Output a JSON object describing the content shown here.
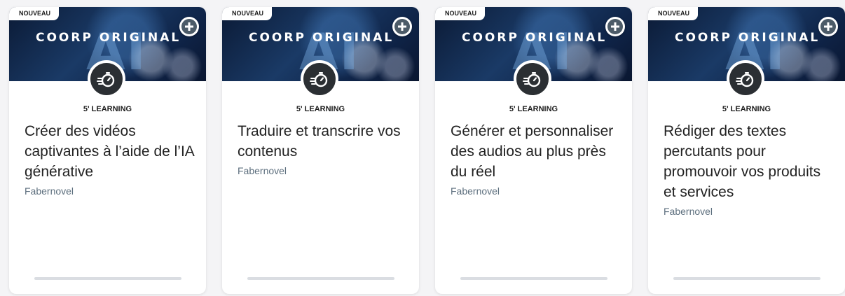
{
  "cards": [
    {
      "badge": "NOUVEAU",
      "banner_title": "COORP ORIGINAL",
      "banner_ai": "AI",
      "type_label": "5' LEARNING",
      "title": "Créer des vidéos captivantes à l’aide de l’IA générative",
      "provider": "Fabernovel",
      "progress": 0
    },
    {
      "badge": "NOUVEAU",
      "banner_title": "COORP ORIGINAL",
      "banner_ai": "AI",
      "type_label": "5' LEARNING",
      "title": "Traduire et transcrire vos contenus",
      "provider": "Fabernovel",
      "progress": 0
    },
    {
      "badge": "NOUVEAU",
      "banner_title": "COORP ORIGINAL",
      "banner_ai": "AI",
      "type_label": "5' LEARNING",
      "title": "Générer et personnaliser des audios au plus près du réel",
      "provider": "Fabernovel",
      "progress": 0
    },
    {
      "badge": "NOUVEAU",
      "banner_title": "COORP ORIGINAL",
      "banner_ai": "AI",
      "type_label": "5' LEARNING",
      "title": "Rédiger des textes percutants pour promouvoir vos produits et services",
      "provider": "Fabernovel",
      "progress": 0
    }
  ],
  "icons": {
    "add": "plus-icon",
    "type": "stopwatch-icon"
  },
  "colors": {
    "accent": "#4c5b68",
    "provider_text": "#5d6f7e",
    "type_icon_bg": "#2b2f33"
  }
}
